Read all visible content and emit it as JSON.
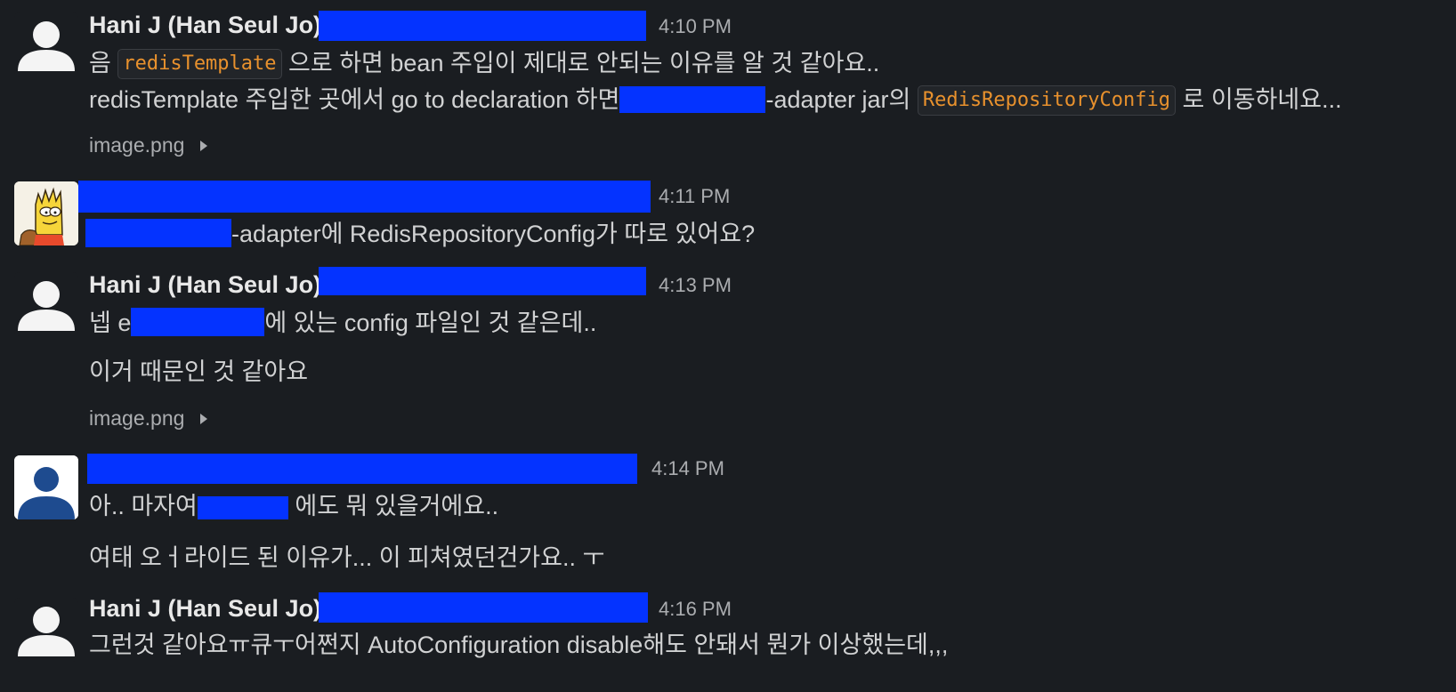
{
  "messages": [
    {
      "author": "Hani J (Han Seul Jo)",
      "time": "4:10 PM",
      "line1": {
        "pre": "음 ",
        "code": "redisTemplate",
        "post": " 으로 하면 bean 주입이 제대로 안되는 이유를 알 것 같아요.."
      },
      "line2": {
        "pre": "redisTemplate 주입한 곳에서 go to declaration 하면",
        "mid": "-adapter jar의 ",
        "code": "RedisRepositoryConfig",
        "post": " 로 이동하네요..."
      },
      "attachment": "image.png"
    },
    {
      "author": "",
      "time": "4:11 PM",
      "line1": "-adapter에 RedisRepositoryConfig가 따로 있어요?"
    },
    {
      "author": "Hani J (Han Seul Jo)",
      "time": "4:13 PM",
      "line1_pre": "넵 e",
      "line1_post": "에 있는 config 파일인 것 같은데..",
      "line2": "이거 때문인 것 같아요",
      "attachment": "image.png"
    },
    {
      "author": "",
      "time": "4:14 PM",
      "line1_pre": "아.. 마자여",
      "line1_post": " 에도 뭐 있을거에요..",
      "line2": "여태 오ㅓ라이드 된 이유가... 이 피쳐였던건가요.. ㅜ"
    },
    {
      "author": "Hani J (Han Seul Jo)",
      "time": "4:16 PM",
      "line1": "그런것 같아요ㅠ큐ㅜ어쩐지 AutoConfiguration disable해도 안돼서 뭔가 이상했는데,,,"
    }
  ],
  "icons": {
    "default_avatar": "person-silhouette-icon",
    "bart_avatar": "cartoon-avatar-icon",
    "attachment_toggle": "caret-right-icon"
  },
  "colors": {
    "background": "#1a1d21",
    "code_text": "#e8912d",
    "redaction": "#0433ff"
  }
}
